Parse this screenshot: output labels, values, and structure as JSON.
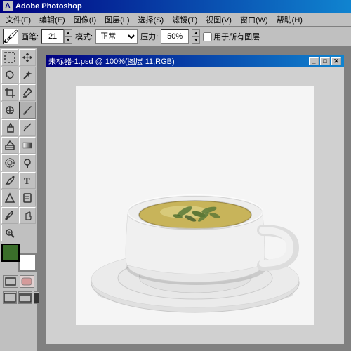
{
  "app": {
    "title": "Adobe Photoshop",
    "title_icon": "Ps"
  },
  "menu": {
    "items": [
      {
        "label": "文件(F)"
      },
      {
        "label": "编辑(E)"
      },
      {
        "label": "图像(I)"
      },
      {
        "label": "图层(L)"
      },
      {
        "label": "选择(S)"
      },
      {
        "label": "滤镜(T)"
      },
      {
        "label": "视图(V)"
      },
      {
        "label": "窗口(W)"
      },
      {
        "label": "帮助(H)"
      }
    ]
  },
  "options_bar": {
    "brush_label": "画笔:",
    "brush_size": "21",
    "mode_label": "模式:",
    "mode_value": "正常",
    "pressure_label": "压力:",
    "pressure_value": "50%",
    "all_layers_label": "用于所有图层"
  },
  "document": {
    "title": "未标器-1.psd @ 100%(图层 11,RGB)"
  },
  "toolbox": {
    "tools": [
      {
        "name": "rectangular-marquee",
        "icon": "⬚"
      },
      {
        "name": "move",
        "icon": "✛"
      },
      {
        "name": "lasso",
        "icon": "⌒"
      },
      {
        "name": "magic-wand",
        "icon": "✦"
      },
      {
        "name": "crop",
        "icon": "⊡"
      },
      {
        "name": "slice",
        "icon": "⧄"
      },
      {
        "name": "healing-brush",
        "icon": "✚"
      },
      {
        "name": "brush",
        "icon": "✏"
      },
      {
        "name": "stamp",
        "icon": "⊕"
      },
      {
        "name": "history-brush",
        "icon": "↺"
      },
      {
        "name": "eraser",
        "icon": "◻"
      },
      {
        "name": "gradient",
        "icon": "▦"
      },
      {
        "name": "blur",
        "icon": "◑"
      },
      {
        "name": "dodge",
        "icon": "○"
      },
      {
        "name": "pen",
        "icon": "✒"
      },
      {
        "name": "text",
        "icon": "T"
      },
      {
        "name": "shape",
        "icon": "✡"
      },
      {
        "name": "notes",
        "icon": "✎"
      },
      {
        "name": "eyedropper",
        "icon": "✆"
      },
      {
        "name": "hand",
        "icon": "☛"
      },
      {
        "name": "zoom",
        "icon": "🔍"
      }
    ],
    "fg_color": "#3a6e2a",
    "bg_color": "#ffffff"
  },
  "tea": {
    "saucer_color": "#e8e8e8",
    "cup_body_color": "#f0f0f0",
    "tea_liquid_color": "#c8b85a",
    "leaf_color": "#5a7a3a"
  }
}
